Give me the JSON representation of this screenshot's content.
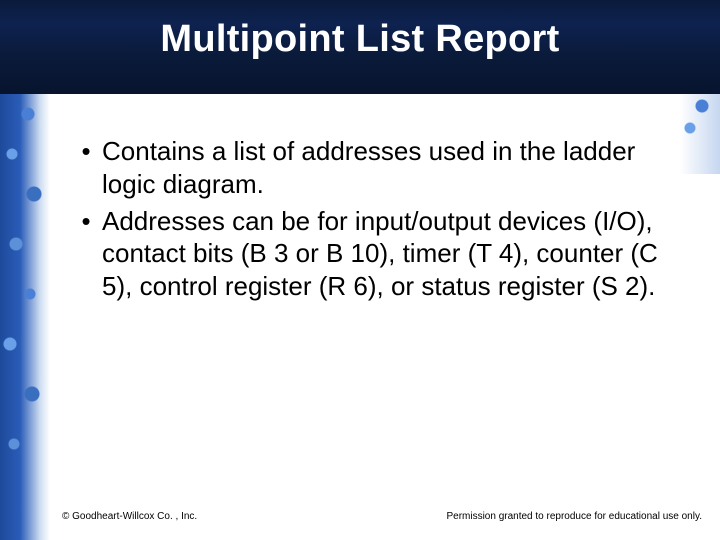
{
  "title": "Multipoint List Report",
  "bullets": [
    "Contains a list of addresses used in the ladder logic diagram.",
    "Addresses can be for input/output devices (I/O), contact bits (B 3 or B 10), timer (T 4), counter (C 5), control register (R 6), or status register (S 2)."
  ],
  "footer": {
    "left": "© Goodheart-Willcox Co. , Inc.",
    "right": "Permission granted to reproduce for educational use only."
  }
}
